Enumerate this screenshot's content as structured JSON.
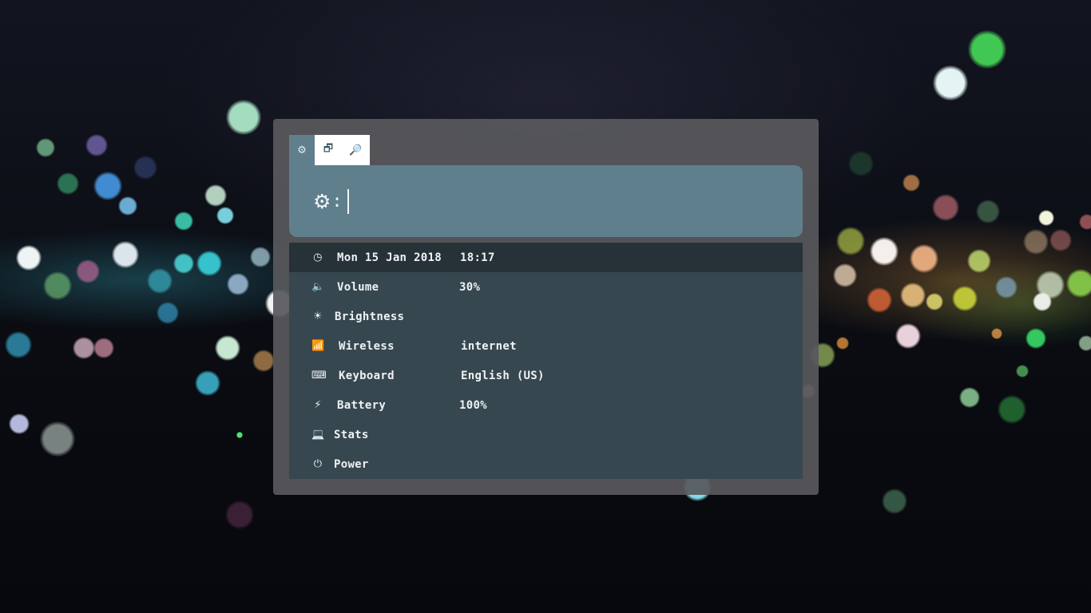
{
  "mode_tabs": [
    {
      "icon": "gear-icon",
      "glyph": "⚙",
      "active": true
    },
    {
      "icon": "window-switcher-icon",
      "glyph": "🗗",
      "active": false
    },
    {
      "icon": "search-icon",
      "glyph": "🔎",
      "active": false
    }
  ],
  "prompt": {
    "icon": "gear-icon",
    "glyph": "⚙",
    "separator": ":",
    "value": ""
  },
  "menu": {
    "items": [
      {
        "icon": "clock-icon",
        "glyph": "◷",
        "label": "Mon 15 Jan 2018",
        "value": "18:17",
        "selected": true
      },
      {
        "icon": "volume-icon",
        "glyph": "🔈",
        "label": "Volume",
        "value": "30%"
      },
      {
        "icon": "brightness-icon",
        "glyph": "☀",
        "label": "Brightness",
        "value": ""
      },
      {
        "icon": "wireless-signal-icon",
        "glyph": "📶",
        "label": "Wireless",
        "value": "internet"
      },
      {
        "icon": "keyboard-icon",
        "glyph": "⌨",
        "label": "Keyboard",
        "value": "English (US)"
      },
      {
        "icon": "battery-charging-icon",
        "glyph": "⚡",
        "label": "Battery",
        "value": "100%"
      },
      {
        "icon": "laptop-icon",
        "glyph": "💻",
        "label": "Stats",
        "value": ""
      },
      {
        "icon": "power-icon",
        "glyph": "⏻",
        "label": "Power",
        "value": ""
      }
    ]
  },
  "colors": {
    "input_bar": "#607f8c",
    "list_bg": "#37474f",
    "selected_row": "#263238",
    "window_bg": "#58585c"
  }
}
